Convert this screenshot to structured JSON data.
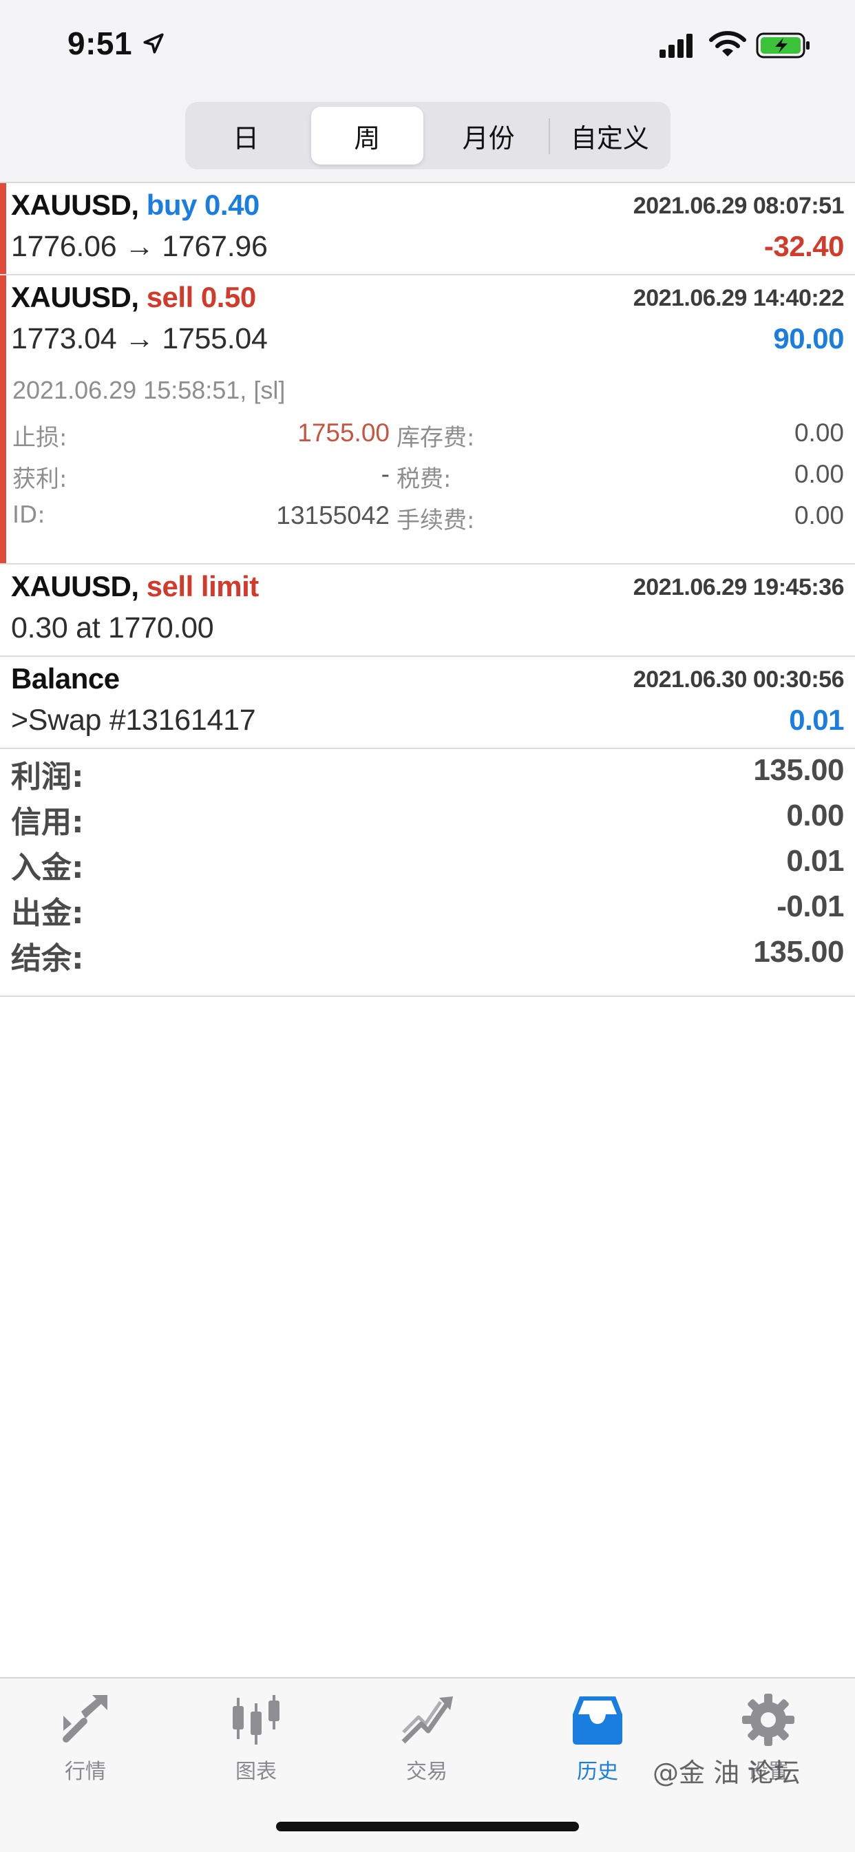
{
  "status_bar": {
    "time": "9:51"
  },
  "segments": [
    {
      "label": "日",
      "active": false
    },
    {
      "label": "周",
      "active": true
    },
    {
      "label": "月份",
      "active": false
    },
    {
      "label": "自定义",
      "active": false
    }
  ],
  "history": {
    "rows": [
      {
        "symbol": "XAUUSD,",
        "action": "buy 0.40",
        "datetime": "2021.06.29 08:07:51",
        "prices": "1776.06 → 1767.96",
        "profit": "-32.40"
      },
      {
        "symbol": "XAUUSD,",
        "action": "sell 0.50",
        "datetime": "2021.06.29 14:40:22",
        "prices": "1773.04 → 1755.04",
        "profit": "90.00",
        "close_info": "2021.06.29 15:58:51, [sl]",
        "details": {
          "sl_label": "止损:",
          "sl_value": "1755.00",
          "tp_label": "获利:",
          "tp_value": "-",
          "id_label": "ID:",
          "id_value": "13155042",
          "swap_label": "库存费:",
          "swap_value": "0.00",
          "tax_label": "税费:",
          "tax_value": "0.00",
          "fee_label": "手续费:",
          "fee_value": "0.00"
        }
      },
      {
        "symbol": "XAUUSD,",
        "action": "sell limit",
        "datetime": "2021.06.29 19:45:36",
        "prices": "0.30 at 1770.00"
      },
      {
        "symbol": "Balance",
        "datetime": "2021.06.30 00:30:56",
        "prices": ">Swap #13161417",
        "profit": "0.01"
      }
    ]
  },
  "summary": [
    {
      "label": "利润:",
      "value": "135.00"
    },
    {
      "label": "信用:",
      "value": "0.00"
    },
    {
      "label": "入金:",
      "value": "0.01"
    },
    {
      "label": "出金:",
      "value": "-0.01"
    },
    {
      "label": "结余:",
      "value": "135.00"
    }
  ],
  "tabs": [
    {
      "label": "行情",
      "icon": "quotes-icon",
      "active": false
    },
    {
      "label": "图表",
      "icon": "chart-icon",
      "active": false
    },
    {
      "label": "交易",
      "icon": "trade-icon",
      "active": false
    },
    {
      "label": "历史",
      "icon": "history-icon",
      "active": true
    },
    {
      "label": "设置",
      "icon": "settings-icon",
      "active": false
    }
  ],
  "watermark": "@金 油 论坛",
  "colors": {
    "accent": "#1a7ee0",
    "sell": "#d23a2c",
    "row_marker": "#e04a3b"
  }
}
